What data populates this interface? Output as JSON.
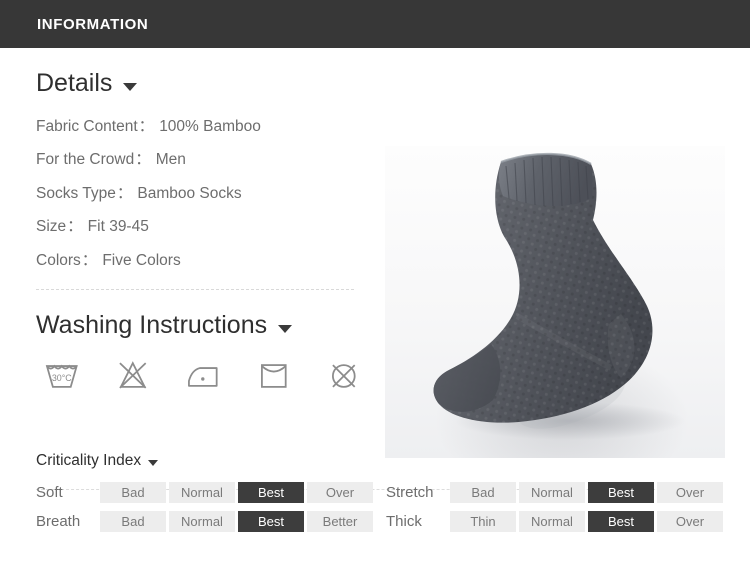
{
  "header": {
    "title": "INFORMATION"
  },
  "details": {
    "heading": "Details",
    "caret_icon": "chevron-down-icon",
    "rows": [
      {
        "label": "Fabric Content",
        "sep": "：",
        "value": "100% Bamboo"
      },
      {
        "label": "For the Crowd",
        "sep": "：",
        "value": "Men"
      },
      {
        "label": "Socks Type",
        "sep": "：",
        "value": "Bamboo Socks"
      },
      {
        "label": "Size",
        "sep": "：",
        "value": "Fit 39-45"
      },
      {
        "label": "Colors",
        "sep": "：",
        "value": "Five Colors"
      }
    ]
  },
  "washing": {
    "heading": "Washing Instructions",
    "caret_icon": "chevron-down-icon",
    "icons": [
      {
        "name": "wash-30c-icon",
        "label": "30°C"
      },
      {
        "name": "do-not-bleach-icon",
        "label": ""
      },
      {
        "name": "iron-low-heat-icon",
        "label": ""
      },
      {
        "name": "line-dry-icon",
        "label": ""
      },
      {
        "name": "do-not-dry-clean-icon",
        "label": ""
      }
    ]
  },
  "product_image": {
    "name": "bamboo-sock-photo",
    "alt": "Dark gray bamboo sock with diamond knit texture"
  },
  "criticality": {
    "heading": "Criticality Index",
    "caret_icon": "chevron-down-icon",
    "rows": [
      {
        "label": "Soft",
        "cells": [
          {
            "text": "Bad",
            "selected": false
          },
          {
            "text": "Normal",
            "selected": false
          },
          {
            "text": "Best",
            "selected": true
          },
          {
            "text": "Over",
            "selected": false
          }
        ]
      },
      {
        "label": "Stretch",
        "cells": [
          {
            "text": "Bad",
            "selected": false
          },
          {
            "text": "Normal",
            "selected": false
          },
          {
            "text": "Best",
            "selected": true
          },
          {
            "text": "Over",
            "selected": false
          }
        ]
      },
      {
        "label": "Breath",
        "cells": [
          {
            "text": "Bad",
            "selected": false
          },
          {
            "text": "Normal",
            "selected": false
          },
          {
            "text": "Best",
            "selected": true
          },
          {
            "text": "Better",
            "selected": false
          }
        ]
      },
      {
        "label": "Thick",
        "cells": [
          {
            "text": "Thin",
            "selected": false
          },
          {
            "text": "Normal",
            "selected": false
          },
          {
            "text": "Best",
            "selected": true
          },
          {
            "text": "Over",
            "selected": false
          }
        ]
      }
    ]
  },
  "colors": {
    "header_bg": "#373737",
    "selected_cell_bg": "#3d3d3d",
    "cell_bg": "#ededed",
    "text": "#6d6d6d",
    "heading_text": "#2f2f2f"
  }
}
